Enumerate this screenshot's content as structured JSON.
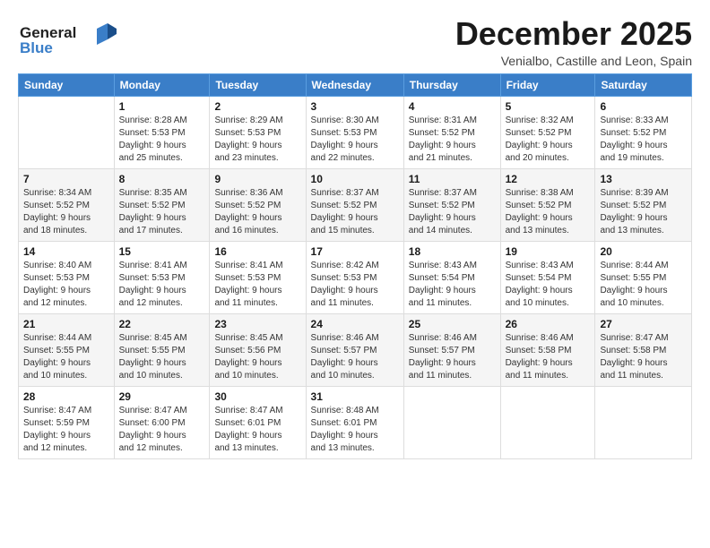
{
  "header": {
    "logo_line1": "General",
    "logo_line2": "Blue",
    "month": "December 2025",
    "location": "Venialbo, Castille and Leon, Spain"
  },
  "days_of_week": [
    "Sunday",
    "Monday",
    "Tuesday",
    "Wednesday",
    "Thursday",
    "Friday",
    "Saturday"
  ],
  "weeks": [
    [
      {
        "num": "",
        "info": ""
      },
      {
        "num": "1",
        "info": "Sunrise: 8:28 AM\nSunset: 5:53 PM\nDaylight: 9 hours\nand 25 minutes."
      },
      {
        "num": "2",
        "info": "Sunrise: 8:29 AM\nSunset: 5:53 PM\nDaylight: 9 hours\nand 23 minutes."
      },
      {
        "num": "3",
        "info": "Sunrise: 8:30 AM\nSunset: 5:53 PM\nDaylight: 9 hours\nand 22 minutes."
      },
      {
        "num": "4",
        "info": "Sunrise: 8:31 AM\nSunset: 5:52 PM\nDaylight: 9 hours\nand 21 minutes."
      },
      {
        "num": "5",
        "info": "Sunrise: 8:32 AM\nSunset: 5:52 PM\nDaylight: 9 hours\nand 20 minutes."
      },
      {
        "num": "6",
        "info": "Sunrise: 8:33 AM\nSunset: 5:52 PM\nDaylight: 9 hours\nand 19 minutes."
      }
    ],
    [
      {
        "num": "7",
        "info": "Sunrise: 8:34 AM\nSunset: 5:52 PM\nDaylight: 9 hours\nand 18 minutes."
      },
      {
        "num": "8",
        "info": "Sunrise: 8:35 AM\nSunset: 5:52 PM\nDaylight: 9 hours\nand 17 minutes."
      },
      {
        "num": "9",
        "info": "Sunrise: 8:36 AM\nSunset: 5:52 PM\nDaylight: 9 hours\nand 16 minutes."
      },
      {
        "num": "10",
        "info": "Sunrise: 8:37 AM\nSunset: 5:52 PM\nDaylight: 9 hours\nand 15 minutes."
      },
      {
        "num": "11",
        "info": "Sunrise: 8:37 AM\nSunset: 5:52 PM\nDaylight: 9 hours\nand 14 minutes."
      },
      {
        "num": "12",
        "info": "Sunrise: 8:38 AM\nSunset: 5:52 PM\nDaylight: 9 hours\nand 13 minutes."
      },
      {
        "num": "13",
        "info": "Sunrise: 8:39 AM\nSunset: 5:52 PM\nDaylight: 9 hours\nand 13 minutes."
      }
    ],
    [
      {
        "num": "14",
        "info": "Sunrise: 8:40 AM\nSunset: 5:53 PM\nDaylight: 9 hours\nand 12 minutes."
      },
      {
        "num": "15",
        "info": "Sunrise: 8:41 AM\nSunset: 5:53 PM\nDaylight: 9 hours\nand 12 minutes."
      },
      {
        "num": "16",
        "info": "Sunrise: 8:41 AM\nSunset: 5:53 PM\nDaylight: 9 hours\nand 11 minutes."
      },
      {
        "num": "17",
        "info": "Sunrise: 8:42 AM\nSunset: 5:53 PM\nDaylight: 9 hours\nand 11 minutes."
      },
      {
        "num": "18",
        "info": "Sunrise: 8:43 AM\nSunset: 5:54 PM\nDaylight: 9 hours\nand 11 minutes."
      },
      {
        "num": "19",
        "info": "Sunrise: 8:43 AM\nSunset: 5:54 PM\nDaylight: 9 hours\nand 10 minutes."
      },
      {
        "num": "20",
        "info": "Sunrise: 8:44 AM\nSunset: 5:55 PM\nDaylight: 9 hours\nand 10 minutes."
      }
    ],
    [
      {
        "num": "21",
        "info": "Sunrise: 8:44 AM\nSunset: 5:55 PM\nDaylight: 9 hours\nand 10 minutes."
      },
      {
        "num": "22",
        "info": "Sunrise: 8:45 AM\nSunset: 5:55 PM\nDaylight: 9 hours\nand 10 minutes."
      },
      {
        "num": "23",
        "info": "Sunrise: 8:45 AM\nSunset: 5:56 PM\nDaylight: 9 hours\nand 10 minutes."
      },
      {
        "num": "24",
        "info": "Sunrise: 8:46 AM\nSunset: 5:57 PM\nDaylight: 9 hours\nand 10 minutes."
      },
      {
        "num": "25",
        "info": "Sunrise: 8:46 AM\nSunset: 5:57 PM\nDaylight: 9 hours\nand 11 minutes."
      },
      {
        "num": "26",
        "info": "Sunrise: 8:46 AM\nSunset: 5:58 PM\nDaylight: 9 hours\nand 11 minutes."
      },
      {
        "num": "27",
        "info": "Sunrise: 8:47 AM\nSunset: 5:58 PM\nDaylight: 9 hours\nand 11 minutes."
      }
    ],
    [
      {
        "num": "28",
        "info": "Sunrise: 8:47 AM\nSunset: 5:59 PM\nDaylight: 9 hours\nand 12 minutes."
      },
      {
        "num": "29",
        "info": "Sunrise: 8:47 AM\nSunset: 6:00 PM\nDaylight: 9 hours\nand 12 minutes."
      },
      {
        "num": "30",
        "info": "Sunrise: 8:47 AM\nSunset: 6:01 PM\nDaylight: 9 hours\nand 13 minutes."
      },
      {
        "num": "31",
        "info": "Sunrise: 8:48 AM\nSunset: 6:01 PM\nDaylight: 9 hours\nand 13 minutes."
      },
      {
        "num": "",
        "info": ""
      },
      {
        "num": "",
        "info": ""
      },
      {
        "num": "",
        "info": ""
      }
    ]
  ]
}
